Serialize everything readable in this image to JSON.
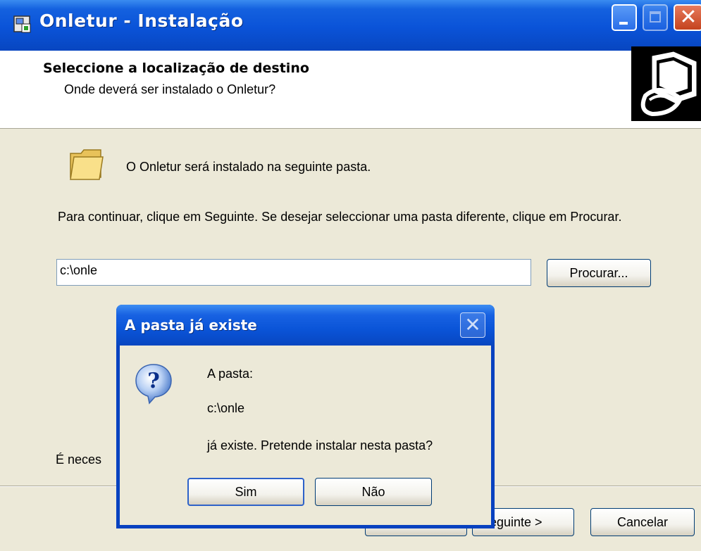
{
  "window": {
    "title": "Onletur - Instalação",
    "controls": [
      "minimize",
      "maximize",
      "close"
    ]
  },
  "header": {
    "title": "Seleccione a localização de destino",
    "subtitle": "Onde deverá ser instalado o Onletur?"
  },
  "body": {
    "install_message": "O Onletur será instalado na seguinte pasta.",
    "continue_message": "Para continuar, clique em Seguinte. Se desejar seleccionar uma pasta diferente, clique em Procurar.",
    "path_value": "c:\\onle",
    "browse_label": "Procurar...",
    "disk_message_partial": "É neces"
  },
  "footer": {
    "back_label": "",
    "next_label": "eguinte >",
    "cancel_label": "Cancelar"
  },
  "dialog": {
    "title": "A pasta já existe",
    "line1": "A pasta:",
    "line2": "c:\\onle",
    "line3": "já existe. Pretende instalar nesta pasta?",
    "yes_label": "Sim",
    "no_label": "Não"
  },
  "icons": {
    "app": "installer-app-icon",
    "header_image": "computer-install-icon",
    "folder": "folder-icon",
    "question": "question-icon"
  },
  "colors": {
    "titlebar": "#0a53d8",
    "window_bg": "#ece9d8",
    "close_button": "#c5431e"
  }
}
